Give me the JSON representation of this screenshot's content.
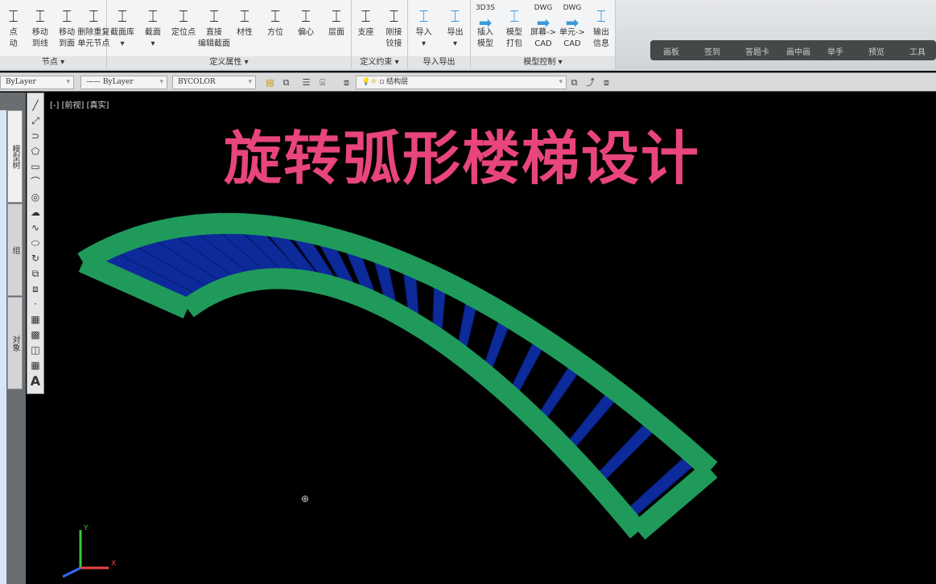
{
  "ribbon": {
    "groups": [
      {
        "title": "节点 ▾",
        "buttons": [
          {
            "l1": "点",
            "l2": "动"
          },
          {
            "l1": "移动",
            "l2": "到线"
          },
          {
            "l1": "移动",
            "l2": "到面"
          },
          {
            "l1": "删除重复",
            "l2": "单元节点"
          }
        ]
      },
      {
        "title": "定义属性 ▾",
        "buttons": [
          {
            "l1": "截面库",
            "l2": "▾"
          },
          {
            "l1": "截面",
            "l2": "▾"
          },
          {
            "l1": "定位点",
            "l2": ""
          },
          {
            "l1": "直接",
            "l2": "编辑截面"
          },
          {
            "l1": "材性",
            "l2": ""
          },
          {
            "l1": "方位",
            "l2": ""
          },
          {
            "l1": "偏心",
            "l2": ""
          },
          {
            "l1": "层面",
            "l2": ""
          }
        ]
      },
      {
        "title": "定义约束 ▾",
        "buttons": [
          {
            "l1": "支座",
            "l2": ""
          },
          {
            "l1": "刚接",
            "l2": "铰接"
          }
        ]
      },
      {
        "title": "导入导出",
        "buttons": [
          {
            "l1": "导入",
            "l2": "▾"
          },
          {
            "l1": "导出",
            "l2": "▾"
          }
        ]
      },
      {
        "title": "模型控制 ▾",
        "buttons": [
          {
            "l1": "插入",
            "l2": "模型",
            "tag": "3D3S"
          },
          {
            "l1": "模型",
            "l2": "打包"
          },
          {
            "l1": "屏幕->",
            "l2": "CAD",
            "tag": "DWG"
          },
          {
            "l1": "单元->",
            "l2": "CAD",
            "tag": "DWG"
          },
          {
            "l1": "输出",
            "l2": "信息"
          }
        ]
      }
    ]
  },
  "overlay_toolbar": [
    "画板",
    "签到",
    "答题卡",
    "画中画",
    "举手",
    "预览",
    "工具"
  ],
  "properties": {
    "color": "ByLayer",
    "linetype": "ByLayer",
    "lineweight": "BYCOLOR",
    "layer": "结构层"
  },
  "side_tabs": [
    "模型树",
    "组",
    "对象"
  ],
  "viewport": {
    "label": "[-] [前视] [真实]",
    "title": "旋转弧形楼梯设计"
  },
  "colors": {
    "stringer": "#1f9a5a",
    "step": "#0d2a9a",
    "title": "#e8457a"
  }
}
